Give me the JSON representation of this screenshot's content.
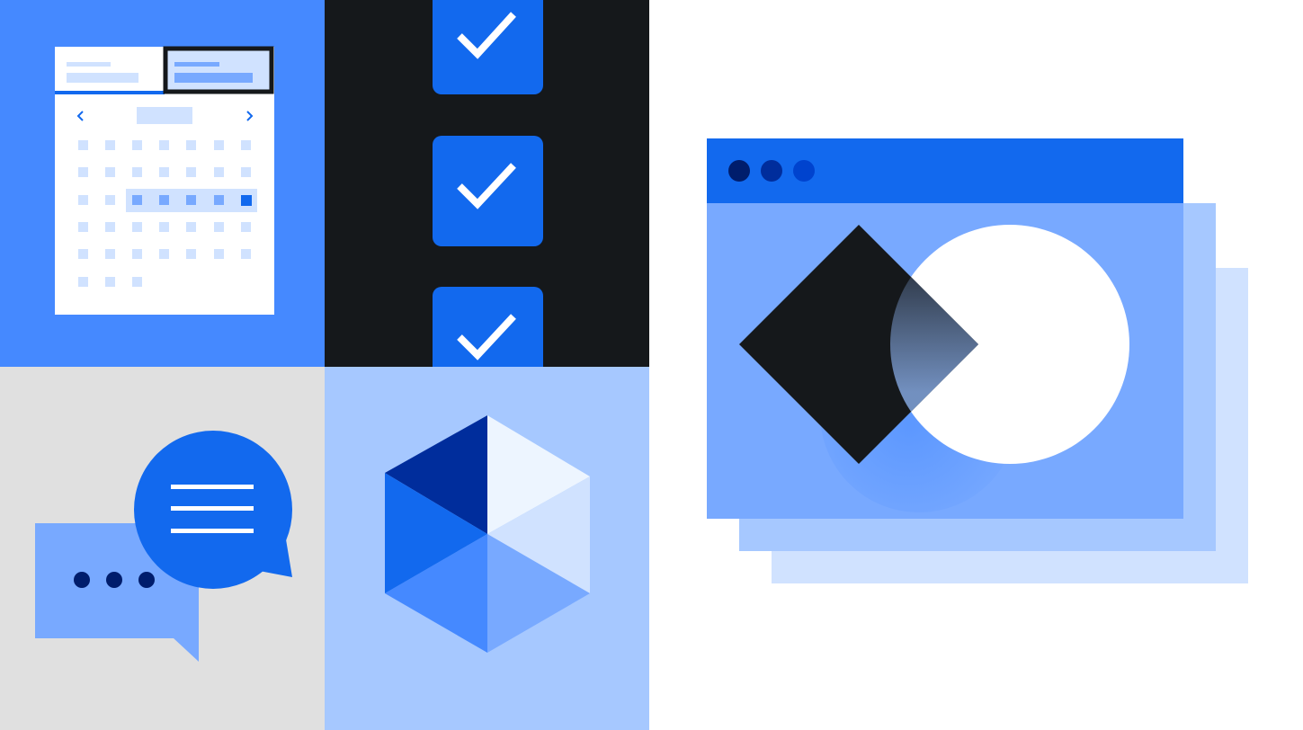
{
  "illustration": {
    "palette": {
      "brand_blue": "#1269ee",
      "medium_blue": "#4589ff",
      "light_blue": "#78a9ff",
      "pale_blue": "#a6c8ff",
      "paler_blue": "#d0e2ff",
      "dark_navy": "#002d9c",
      "deep_navy": "#001d6c",
      "near_black": "#15181b",
      "neutral_gray": "#e0e0e0",
      "white": "#ffffff"
    },
    "tiles": [
      {
        "id": "calendar",
        "icon": "calendar-icon",
        "background": "#4589ff"
      },
      {
        "id": "checklist",
        "icon": "checkmark-icon",
        "background": "#15181b",
        "checked_count": 3
      },
      {
        "id": "chat",
        "icon": "chat-bubbles-icon",
        "background": "#e0e0e0"
      },
      {
        "id": "hexagon",
        "icon": "hexagon-cube-icon",
        "background": "#a6c8ff"
      }
    ],
    "browser_window": {
      "icon": "browser-window-icon",
      "titlebar_dots": 3,
      "shapes": [
        "diamond-shape",
        "circle-shape"
      ],
      "stacked_layers": 2
    }
  }
}
